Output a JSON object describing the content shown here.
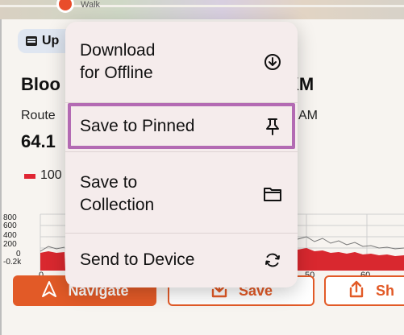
{
  "map": {
    "label": "Walk"
  },
  "header": {
    "upload_label": "Up",
    "title_left": "Bloo",
    "title_right": "KM",
    "sub_left": "Route",
    "sub_right": "AM",
    "big_value": "64.1",
    "legend_label": "100"
  },
  "chart": {
    "yticks": [
      "800",
      "600",
      "400",
      "200",
      "0",
      "-0.2k"
    ],
    "xticks": [
      "0",
      "50",
      "60"
    ]
  },
  "context_menu": {
    "items": [
      {
        "label_line1": "Download",
        "label_line2": "for Offline",
        "icon": "download-circle-icon"
      },
      {
        "label_line1": "Save to Pinned",
        "label_line2": "",
        "icon": "pin-icon",
        "highlighted": true
      },
      {
        "label_line1": "Save to",
        "label_line2": "Collection",
        "icon": "folder-icon"
      },
      {
        "label_line1": "Send to Device",
        "label_line2": "",
        "icon": "sync-icon"
      }
    ]
  },
  "actions": {
    "navigate_label": "Navigate",
    "save_label": "Save",
    "share_label": "Sh"
  },
  "colors": {
    "accent": "#e25a27",
    "highlight": "#b36ab3",
    "menu_bg": "#f5ecec",
    "elevation": "#e02633"
  }
}
